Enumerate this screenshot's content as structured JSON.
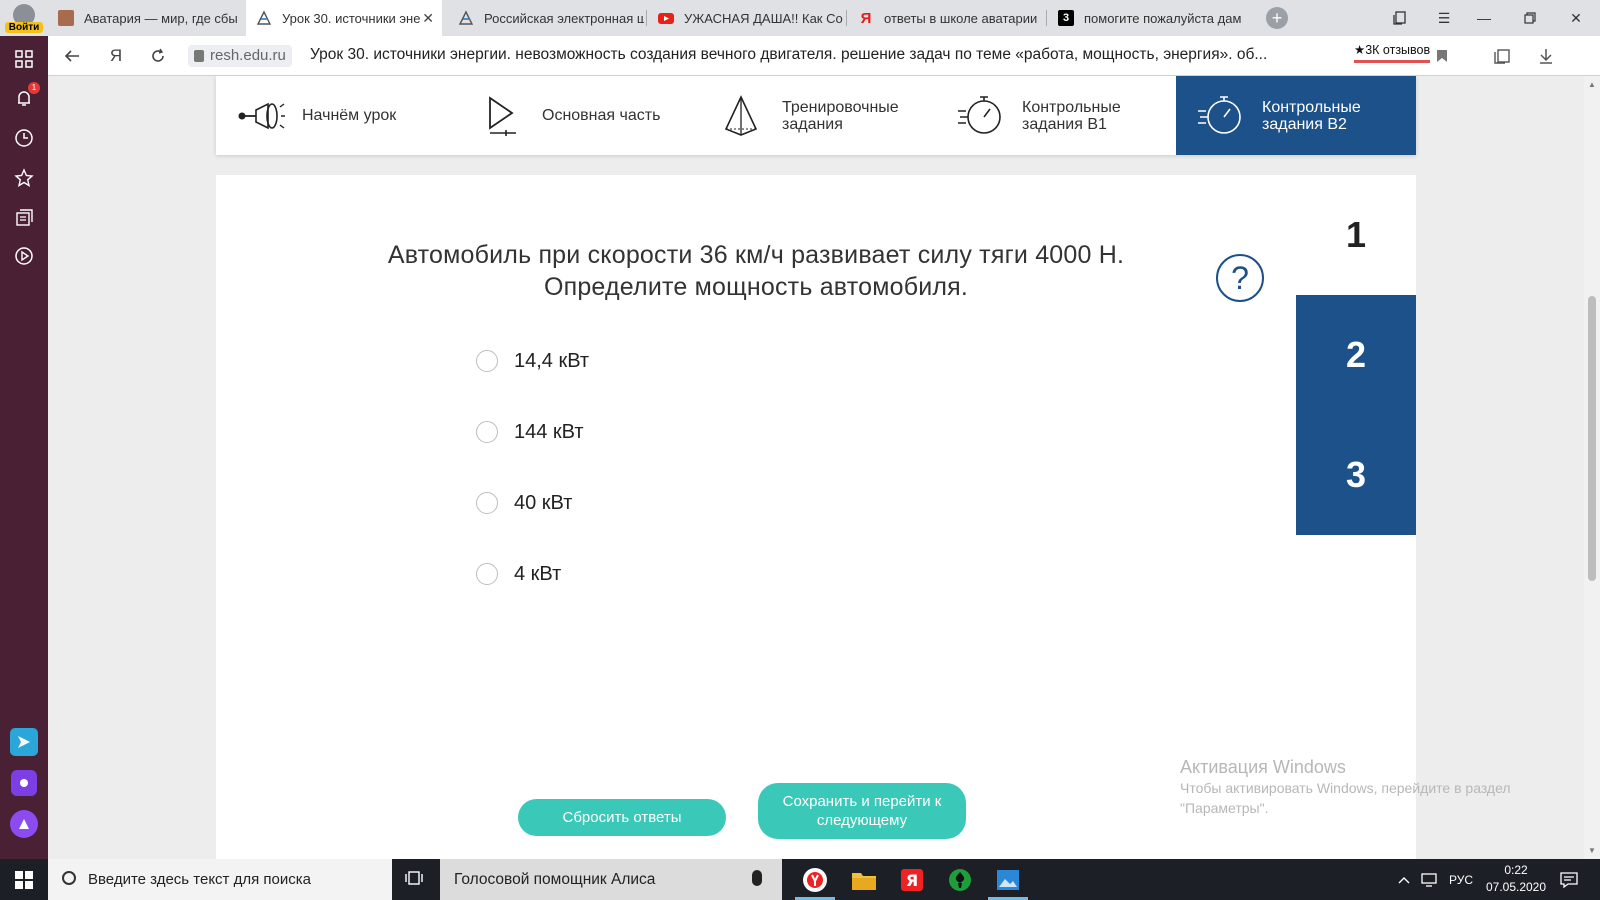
{
  "browser": {
    "profile_label": "Войти",
    "tabs": [
      {
        "label": "Аватария — мир, где сбы",
        "active": false,
        "icon": "avatar-favicon"
      },
      {
        "label": "Урок 30. источники эне",
        "active": true,
        "icon": "resh-favicon"
      },
      {
        "label": "Российская электронная ш",
        "active": false,
        "icon": "resh-favicon"
      },
      {
        "label": "УЖАСНАЯ ДАША!! Как Со",
        "active": false,
        "icon": "youtube-favicon"
      },
      {
        "label": "ответы в школе аватарии",
        "active": false,
        "icon": "yandex-favicon"
      },
      {
        "label": "помогите пожалуйста дам",
        "active": false,
        "icon": "znanija-favicon"
      }
    ],
    "url_domain": "resh.edu.ru",
    "page_title": "Урок 30. источники энергии. невозможность создания вечного двигателя. решение задач по теме «работа, мощность, энергия». об...",
    "reviews_label": "★3К отзывов",
    "notification_count": "1"
  },
  "lesson_nav": {
    "items": [
      {
        "label": "Начнём урок",
        "icon": "flashlight-icon",
        "active": false
      },
      {
        "label": "Основная часть",
        "icon": "play-icon",
        "active": false
      },
      {
        "label": "Тренировочные задания",
        "icon": "pyramid-icon",
        "active": false
      },
      {
        "label": "Контрольные задания В1",
        "icon": "stopwatch-icon",
        "active": false
      },
      {
        "label": "Контрольные задания В2",
        "icon": "stopwatch-icon",
        "active": true
      }
    ]
  },
  "task": {
    "question": "Автомобиль при скорости 36 км/ч развивает силу тяги 4000 Н. Определите мощность автомобиля.",
    "help_symbol": "?",
    "options": [
      "14,4 кВт",
      "144 кВт",
      "40 кВт",
      "4 кВт"
    ],
    "steps": [
      "1",
      "2",
      "3"
    ],
    "reset_label": "Сбросить ответы",
    "next_label": "Сохранить и перейти к следующему"
  },
  "watermark": {
    "title": "Активация Windows",
    "line1": "Чтобы активировать Windows, перейдите в раздел",
    "line2": "\"Параметры\"."
  },
  "taskbar": {
    "search_placeholder": "Введите здесь текст для поиска",
    "alice_label": "Голосовой помощник Алиса",
    "lang": "РУС",
    "time": "0:22",
    "date": "07.05.2020"
  },
  "colors": {
    "accent": "#1d5189",
    "button": "#3ac8b8",
    "sidebar": "#4a2035"
  }
}
